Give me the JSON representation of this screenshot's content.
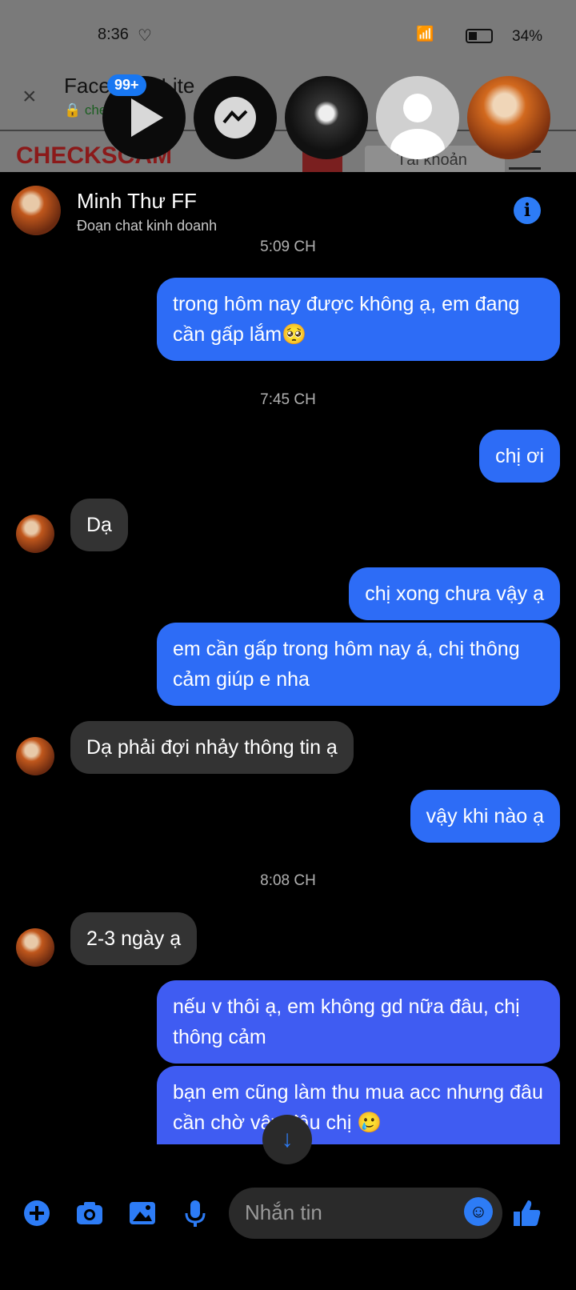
{
  "status_bar": {
    "time": "8:36",
    "battery": "34%"
  },
  "browser": {
    "title": "Facebook Lite",
    "url": "checkscam",
    "site_logo": "CHECKSCAM",
    "account_button": "Tài khoản",
    "close_icon": "close-icon"
  },
  "chat_heads": {
    "badge": "99+"
  },
  "chat": {
    "contact_name": "Minh Thư FF",
    "subtitle": "Đoạn chat kinh doanh",
    "messages": [
      {
        "type": "time",
        "text": "5:09 CH"
      },
      {
        "type": "out",
        "text": "trong hôm nay được không ạ, em đang cần gấp lắm🥺"
      },
      {
        "type": "time",
        "text": "7:45 CH"
      },
      {
        "type": "out",
        "text": "chị ơi"
      },
      {
        "type": "in",
        "text": "Dạ"
      },
      {
        "type": "out",
        "text": "chị xong chưa vậy ạ"
      },
      {
        "type": "out",
        "text": "em cần gấp trong hôm nay á, chị thông cảm giúp e nha"
      },
      {
        "type": "in",
        "text": "Dạ phải đợi nhảy thông tin ạ"
      },
      {
        "type": "out",
        "text": "vậy khi nào ạ"
      },
      {
        "type": "time",
        "text": "8:08 CH"
      },
      {
        "type": "in",
        "text": "2-3 ngày ạ"
      },
      {
        "type": "out",
        "text": "nếu v thôi ạ, em không gd nữa đâu, chị thông cảm"
      },
      {
        "type": "out",
        "text": "bạn em cũng làm thu mua acc nhưng đâu cần chờ vậy đâu chị 🥲"
      }
    ]
  },
  "composer": {
    "placeholder": "Nhắn tin"
  },
  "colors": {
    "accent": "#2d7cf6",
    "bubble_out": "#2d6cf6",
    "bubble_in": "#333333"
  }
}
